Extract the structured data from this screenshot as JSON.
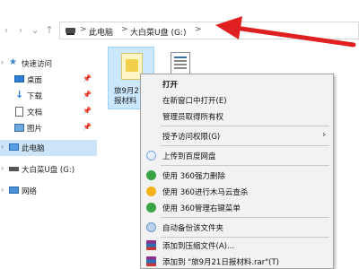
{
  "addressbar": {
    "crumbs": [
      "此电脑",
      "大白菜U盘 (G:)"
    ],
    "separator": ">"
  },
  "sidebar": {
    "items": [
      {
        "label": "快速访问"
      },
      {
        "label": "桌面"
      },
      {
        "label": "下载"
      },
      {
        "label": "文档"
      },
      {
        "label": "图片"
      },
      {
        "label": "此电脑"
      },
      {
        "label": "大白菜U盘 (G:)"
      },
      {
        "label": "网络"
      }
    ]
  },
  "files": [
    {
      "name_line1": "旅9月21",
      "name_line2": "报材料"
    }
  ],
  "context_menu": {
    "items": [
      {
        "label": "打开"
      },
      {
        "label": "在新窗口中打开(E)"
      },
      {
        "label": "管理员取得所有权"
      },
      {
        "label": "授予访问权限(G)"
      },
      {
        "label": "上传到百度网盘"
      },
      {
        "label": "使用 360强力删除"
      },
      {
        "label": "使用 360进行木马云查杀"
      },
      {
        "label": "使用 360管理右键菜单"
      },
      {
        "label": "自动备份该文件夹"
      },
      {
        "label": "添加到压缩文件(A)..."
      },
      {
        "label": "添加到 \"旅9月21日报材料.rar\"(T)"
      }
    ]
  },
  "colors": {
    "accent": "#cce4f7",
    "annotation_arrow": "#e02020"
  }
}
